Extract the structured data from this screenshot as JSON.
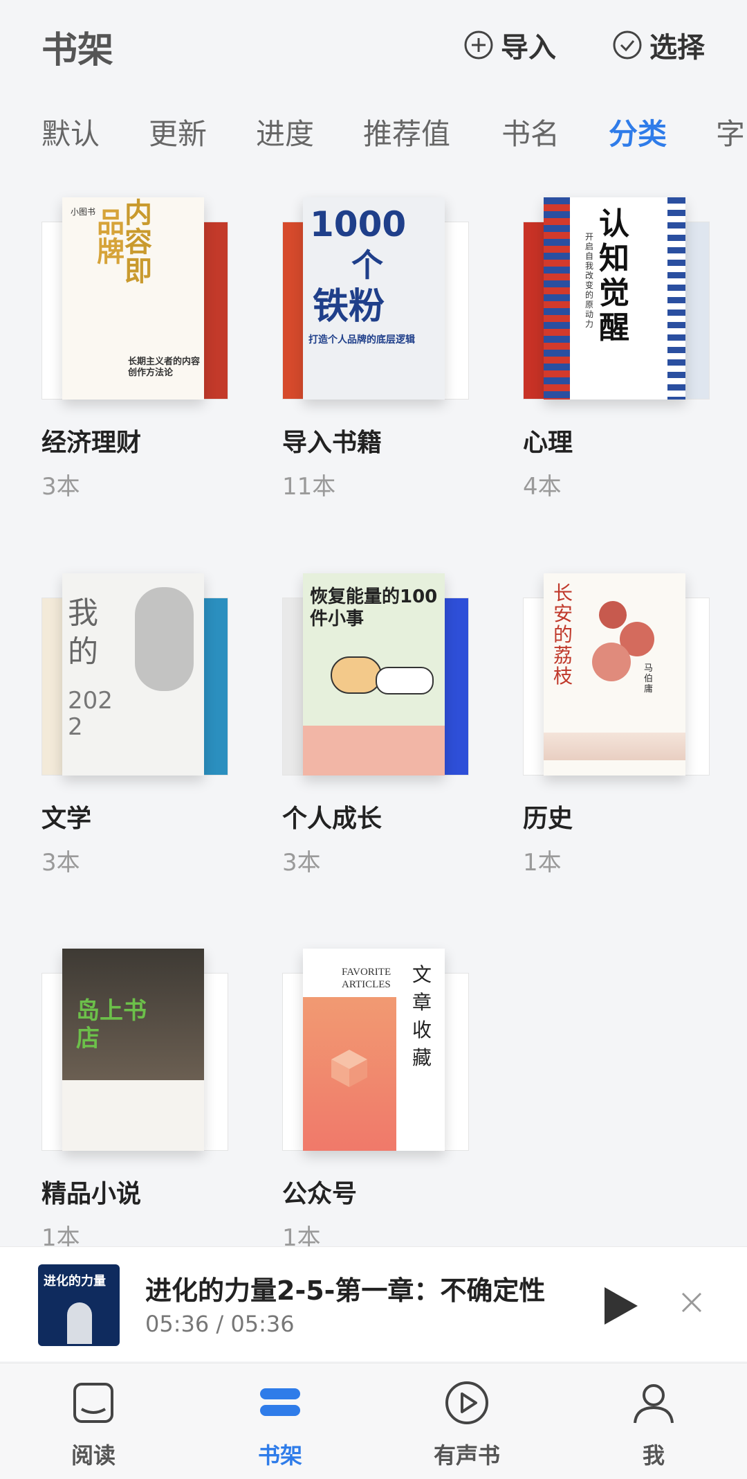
{
  "header": {
    "title": "书架",
    "import_label": "导入",
    "select_label": "选择"
  },
  "sort_tabs": [
    "默认",
    "更新",
    "进度",
    "推荐值",
    "书名",
    "分类",
    "字"
  ],
  "active_sort": "分类",
  "categories": [
    {
      "name": "经济理财",
      "count": "3本",
      "cover": {
        "top_tag": "小图书",
        "left": "品牌",
        "right": "内容即",
        "tagline": "长期主义者的内容创作方法论"
      }
    },
    {
      "name": "导入书籍",
      "count": "11本",
      "cover": {
        "headline_top": "1000",
        "headline_mid": "个",
        "headline_bottom": "铁粉",
        "subtitle": "打造个人品牌的底层逻辑"
      }
    },
    {
      "name": "心理",
      "count": "4本",
      "cover": {
        "title": "认知觉醒",
        "subtitle": "开启自我改变的原动力"
      }
    },
    {
      "name": "文学",
      "count": "3本",
      "cover": {
        "title_top": "我的",
        "year": "2022"
      }
    },
    {
      "name": "个人成长",
      "count": "3本",
      "cover": {
        "title": "恢复能量的100件小事"
      }
    },
    {
      "name": "历史",
      "count": "1本",
      "cover": {
        "title": "长安的荔枝",
        "author": "马伯庸"
      }
    },
    {
      "name": "精品小说",
      "count": "1本",
      "cover": {
        "title": "岛上书店"
      }
    },
    {
      "name": "公众号",
      "count": "1本",
      "cover": {
        "en_title": "FAVORITE ARTICLES",
        "cn_title": "文章收藏"
      }
    }
  ],
  "player": {
    "title": "进化的力量2-5-第一章：不确定性",
    "time": "05:36 / 05:36",
    "thumb_text": "进化的力量"
  },
  "tabbar": [
    {
      "label": "阅读",
      "icon": "book-open-icon"
    },
    {
      "label": "书架",
      "icon": "bookshelf-icon"
    },
    {
      "label": "有声书",
      "icon": "play-circle-icon"
    },
    {
      "label": "我",
      "icon": "person-icon"
    }
  ],
  "colors": {
    "accent": "#2f7ce9",
    "background": "#f4f5f7"
  }
}
